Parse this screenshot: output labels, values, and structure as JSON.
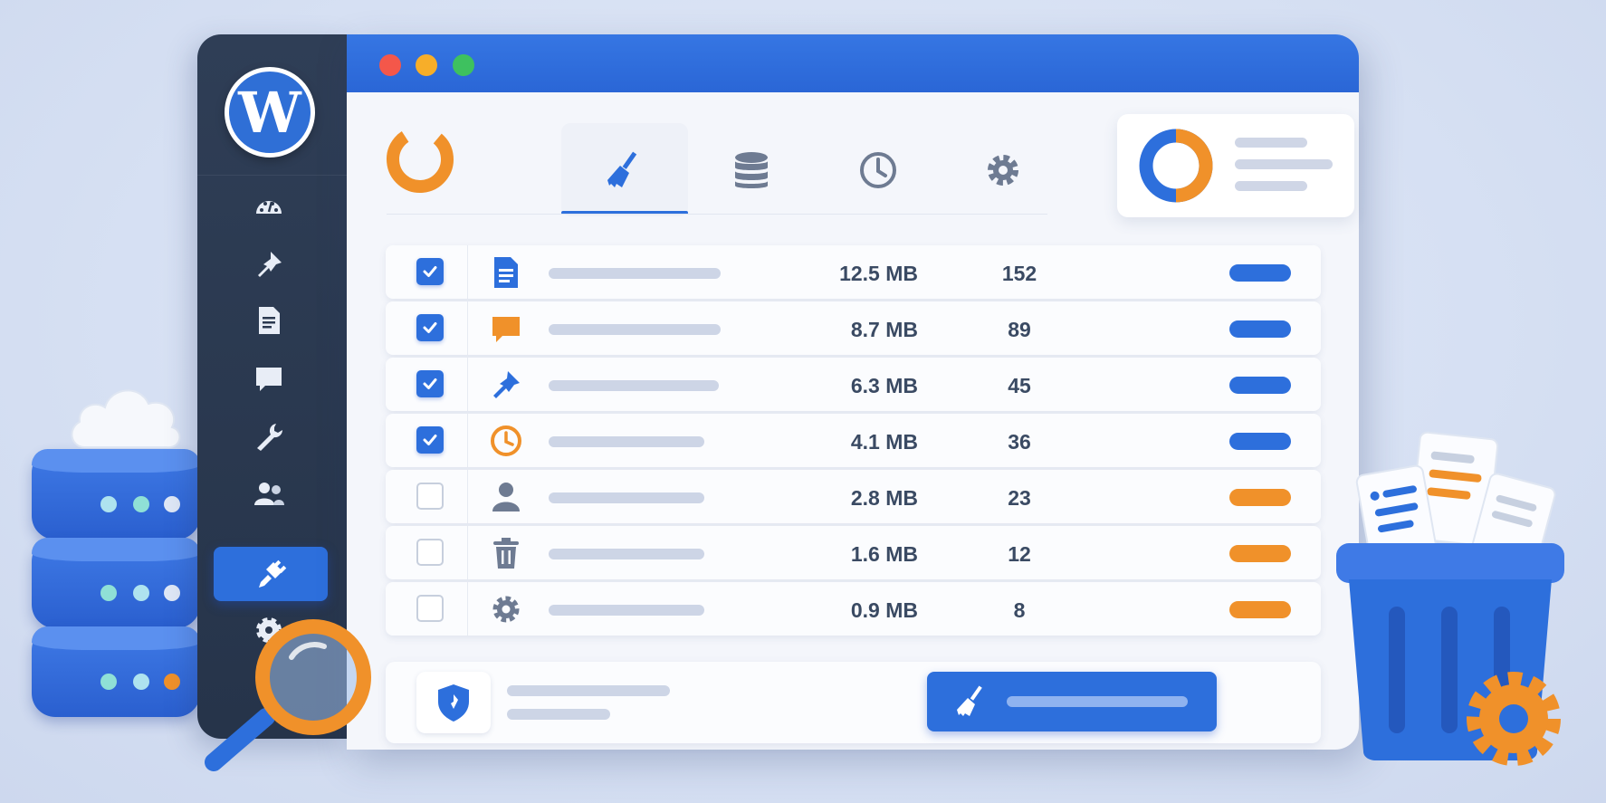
{
  "colors": {
    "accent_blue": "#2d6fdc",
    "accent_orange": "#f0912a",
    "sidebar_bg": "#2b3950",
    "window_bg": "#f4f6fb"
  },
  "window": {
    "controls": [
      "close",
      "minimize",
      "maximize"
    ],
    "brand_icon": "donut-logo-icon"
  },
  "sidebar": {
    "logo_icon": "wordpress-logo-icon",
    "items": [
      {
        "icon": "dashboard-icon",
        "active": false
      },
      {
        "icon": "pin-icon",
        "active": false
      },
      {
        "icon": "page-icon",
        "active": false
      },
      {
        "icon": "comment-icon",
        "active": false
      },
      {
        "icon": "wrench-icon",
        "active": false
      },
      {
        "icon": "users-icon",
        "active": false
      },
      {
        "icon": "plugin-icon",
        "active": true
      },
      {
        "icon": "settings-icon",
        "active": false
      }
    ]
  },
  "tabs": [
    {
      "icon": "broom-icon",
      "active": true
    },
    {
      "icon": "database-icon",
      "active": false
    },
    {
      "icon": "clock-icon",
      "active": false
    },
    {
      "icon": "gear-icon",
      "active": false
    }
  ],
  "summary": {
    "chart_icon": "donut-chart-icon",
    "split": [
      0.5,
      0.5
    ]
  },
  "table": {
    "rows": [
      {
        "checked": true,
        "icon": "document-icon",
        "size": "12.5 MB",
        "count": "152",
        "status": "blue"
      },
      {
        "checked": true,
        "icon": "comment-icon",
        "size": "8.7 MB",
        "count": "89",
        "status": "blue"
      },
      {
        "checked": true,
        "icon": "pin-icon",
        "size": "6.3 MB",
        "count": "45",
        "status": "blue"
      },
      {
        "checked": true,
        "icon": "clock-icon",
        "size": "4.1 MB",
        "count": "36",
        "status": "blue"
      },
      {
        "checked": false,
        "icon": "user-icon",
        "size": "2.8 MB",
        "count": "23",
        "status": "orange"
      },
      {
        "checked": false,
        "icon": "trash-icon",
        "size": "1.6 MB",
        "count": "12",
        "status": "orange"
      },
      {
        "checked": false,
        "icon": "gear-icon",
        "size": "0.9 MB",
        "count": "8",
        "status": "orange"
      }
    ]
  },
  "footer": {
    "shield_icon": "shield-icon",
    "clean_button_icon": "broom-icon"
  },
  "decorations": [
    "server-stack",
    "cloud-icon",
    "magnifier-icon",
    "trash-bin-with-papers",
    "gear-icon"
  ]
}
